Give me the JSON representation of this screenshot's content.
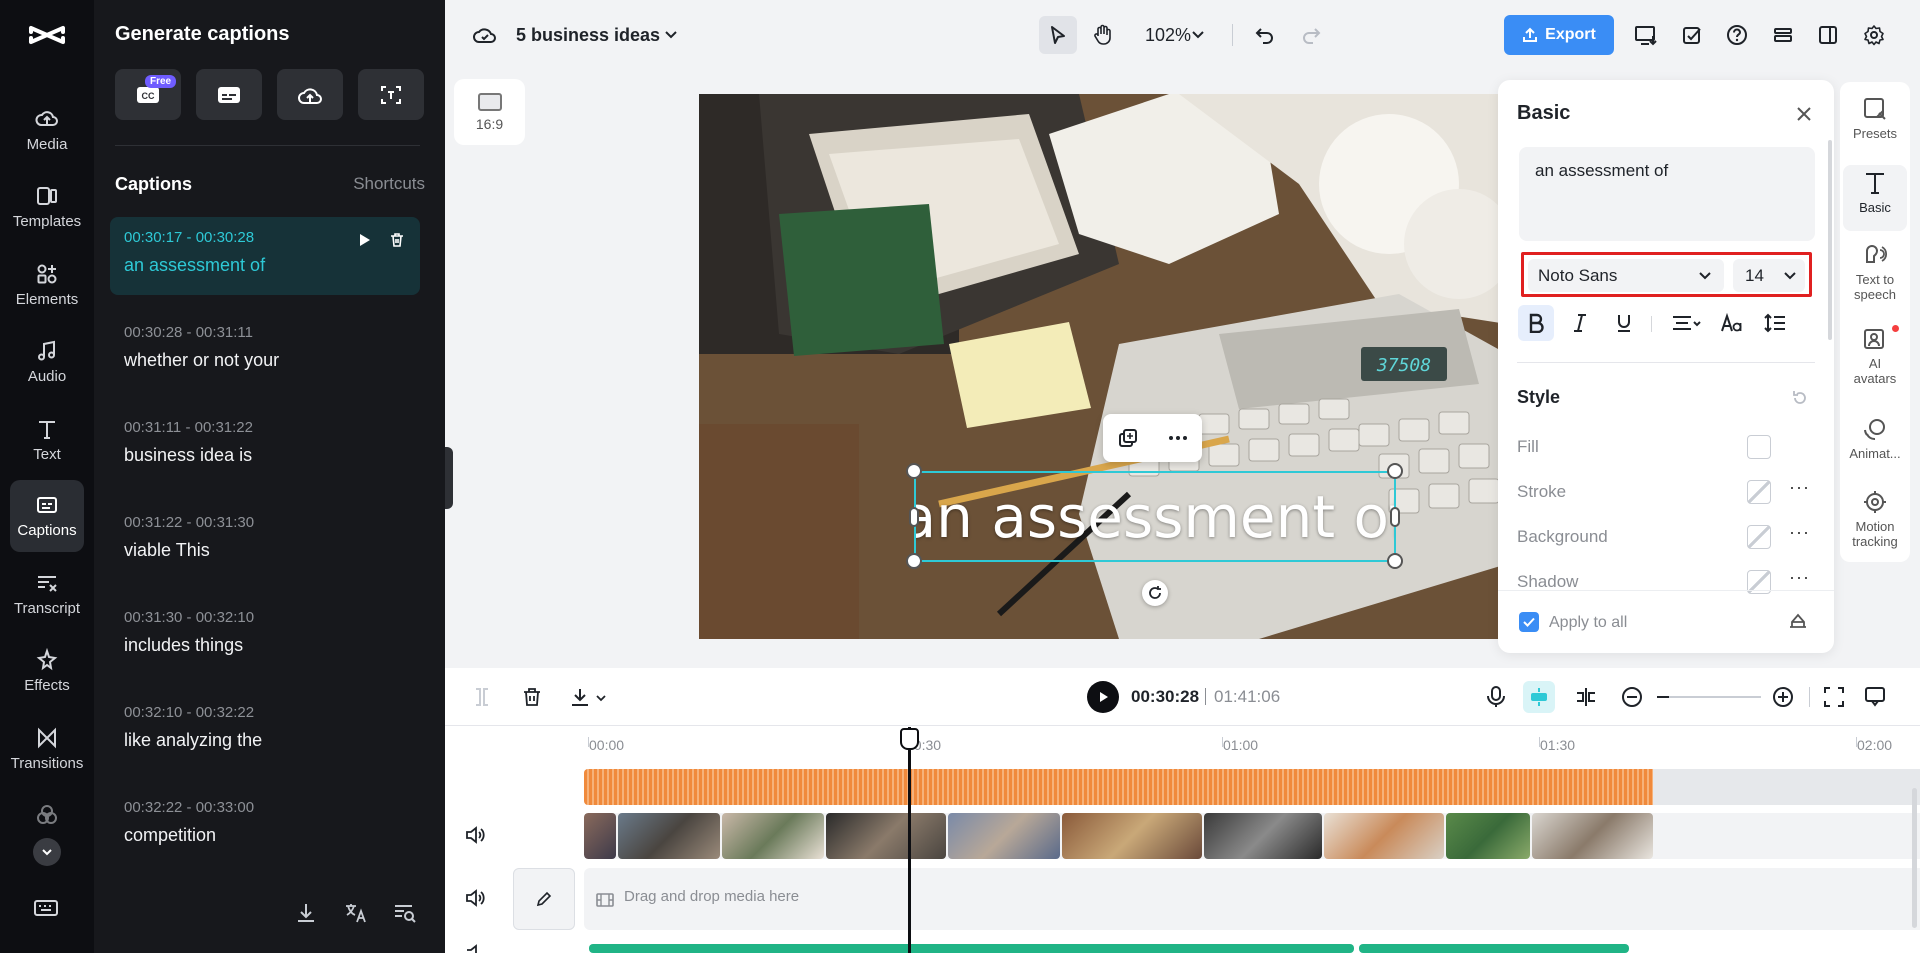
{
  "sidebar": {
    "items": [
      {
        "label": "Media",
        "icon": "cloud-upload-icon"
      },
      {
        "label": "Templates",
        "icon": "templates-icon"
      },
      {
        "label": "Elements",
        "icon": "elements-icon"
      },
      {
        "label": "Audio",
        "icon": "music-note-icon"
      },
      {
        "label": "Text",
        "icon": "text-icon"
      },
      {
        "label": "Captions",
        "icon": "captions-icon",
        "active": true
      },
      {
        "label": "Transcript",
        "icon": "transcript-icon"
      },
      {
        "label": "Effects",
        "icon": "effects-icon"
      },
      {
        "label": "Transitions",
        "icon": "transitions-icon"
      },
      {
        "label": "Filters",
        "icon": "filters-icon"
      }
    ]
  },
  "captions_panel": {
    "title": "Generate captions",
    "free_badge": "Free",
    "section_title": "Captions",
    "shortcuts": "Shortcuts",
    "items": [
      {
        "time": "00:30:17 - 00:30:28",
        "text": "an assessment of",
        "selected": true
      },
      {
        "time": "00:30:28 - 00:31:11",
        "text": "whether or not your"
      },
      {
        "time": "00:31:11 - 00:31:22",
        "text": "business idea is"
      },
      {
        "time": "00:31:22 - 00:31:30",
        "text": "viable This"
      },
      {
        "time": "00:31:30 - 00:32:10",
        "text": "includes things"
      },
      {
        "time": "00:32:10 - 00:32:22",
        "text": "like analyzing the"
      },
      {
        "time": "00:32:22 - 00:33:00",
        "text": "competition"
      }
    ]
  },
  "header": {
    "project_name": "5 business ideas",
    "zoom": "102%",
    "export_label": "Export"
  },
  "canvas": {
    "ratio_label": "16:9",
    "caption_text": "an assessment of"
  },
  "basic_panel": {
    "title": "Basic",
    "text_value": "an assessment of",
    "font": "Noto Sans",
    "font_size": "14",
    "style_title": "Style",
    "style_rows": [
      "Fill",
      "Stroke",
      "Background",
      "Shadow"
    ],
    "apply_to_all": "Apply to all"
  },
  "right_tabs": [
    {
      "label": "Presets",
      "icon": "presets-icon"
    },
    {
      "label": "Basic",
      "icon": "text-t-icon",
      "active": true
    },
    {
      "label": "Text to speech",
      "icon": "text-to-speech-icon"
    },
    {
      "label": "AI avatars",
      "icon": "ai-avatar-icon"
    },
    {
      "label": "Animat...",
      "icon": "animation-icon"
    },
    {
      "label": "Motion tracking",
      "icon": "motion-tracking-icon"
    }
  ],
  "timeline": {
    "current_time": "00:30:28",
    "total_time": "01:41:06",
    "ruler": [
      "00:00",
      "00:30",
      "01:00",
      "01:30",
      "02:00"
    ],
    "drop_label": "Drag and drop media here"
  },
  "colors": {
    "accent": "#3a8df5",
    "caption_highlight": "#2ec9d6",
    "audio_wave": "#f08a3c",
    "selection_outline": "#e02020"
  }
}
